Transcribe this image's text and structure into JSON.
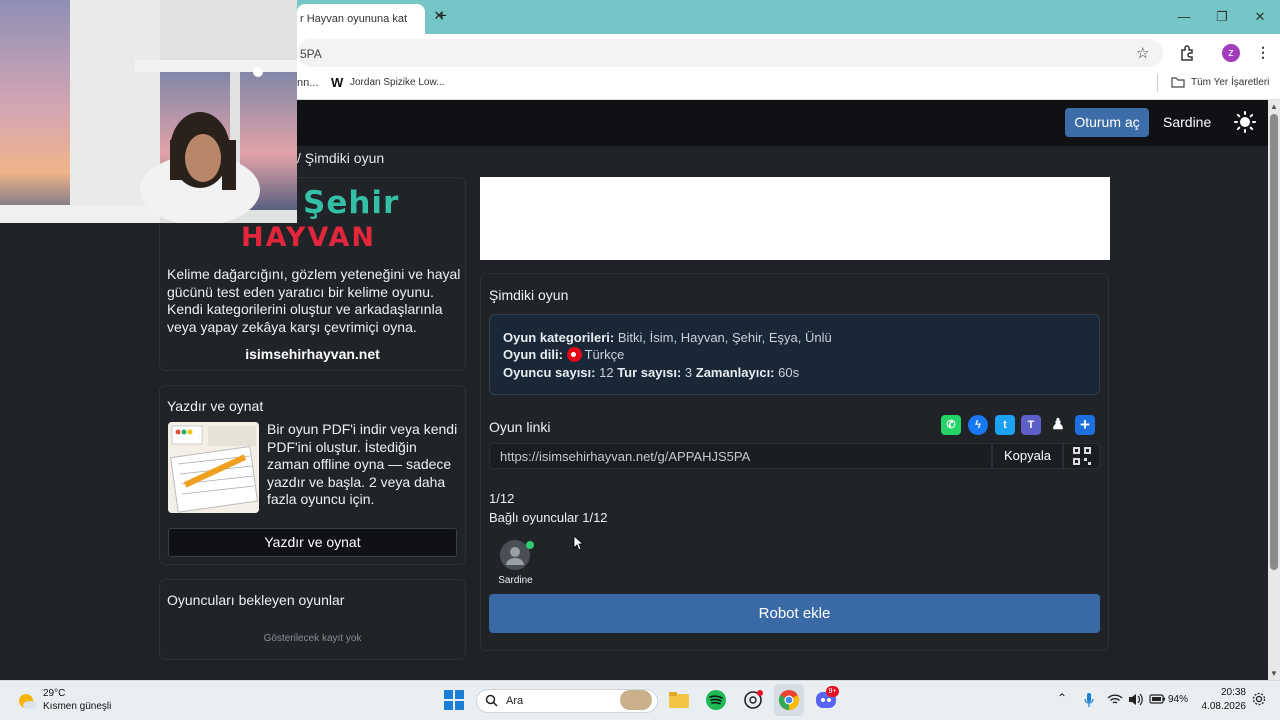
{
  "browser": {
    "tab_title": "r Hayvan oyununa kat",
    "tab_close": "✕",
    "new_tab": "+",
    "url": "5PA",
    "bookmark_1": "nn...",
    "bookmark_2": "Jordan Spizike Low...",
    "bookmark_2_icon": "W",
    "all_bookmarks": "Tüm Yer İşaretleri",
    "profile_initial": "z"
  },
  "navbar": {
    "login_label": "Oturum aç",
    "user_name": "Sardine"
  },
  "breadcrumb": "/  Şimdiki oyun",
  "left": {
    "logo_top": "Şehir",
    "logo_bottom": "HAYVAN",
    "description": "Kelime dağarcığını, gözlem yeteneğini ve hayal gücünü test eden yaratıcı bir kelime oyunu. Kendi kategorilerini oluştur ve arkadaşlarınla veya yapay zekâya karşı çevrimiçi oyna.",
    "site": "isimsehirhayvan.net",
    "print_title": "Yazdır ve oynat",
    "print_desc": "Bir oyun PDF'i indir veya kendi PDF'ini oluştur. İstediğin zaman offline oyna — sadece yazdır ve başla. 2 veya daha fazla oyuncu için.",
    "print_button": "Yazdır ve oynat",
    "waiting_title": "Oyuncuları bekleyen oyunlar",
    "no_records": "Gösterilecek kayıt yok"
  },
  "game": {
    "title": "Şimdiki oyun",
    "categories_label": "Oyun kategorileri:",
    "categories_value": "Bitki, İsim, Hayvan, Şehir, Eşya, Ünlü",
    "language_label": "Oyun dili:",
    "language_value": "Türkçe",
    "players_label": "Oyuncu sayısı:",
    "players_value": "12",
    "rounds_label": "Tur sayısı:",
    "rounds_value": "3",
    "timer_label": "Zamanlayıcı:",
    "timer_value": "60s",
    "link_label": "Oyun linki",
    "link_value": "https://isimsehirhayvan.net/g/APPAHJS5PA",
    "copy_label": "Kopyala",
    "count": "1/12",
    "connected": "Bağlı oyuncular 1/12",
    "player_name": "Sardine",
    "robot_button": "Robot ekle",
    "share_icons": [
      "whatsapp-icon",
      "messenger-icon",
      "twitter-icon",
      "teams-icon",
      "snapchat-icon",
      "share-plus-icon"
    ]
  },
  "taskbar": {
    "temp": "29°C",
    "weather": "Kısmen güneşli",
    "search": "Ara",
    "battery": "94%",
    "time": "20:38",
    "date": "4.08.2026",
    "discord_badge": "9+"
  },
  "colors": {
    "accent": "#3d6da8",
    "tabbar": "#74c7c6",
    "logo_teal": "#33c0a6",
    "logo_red": "#e2263b"
  }
}
